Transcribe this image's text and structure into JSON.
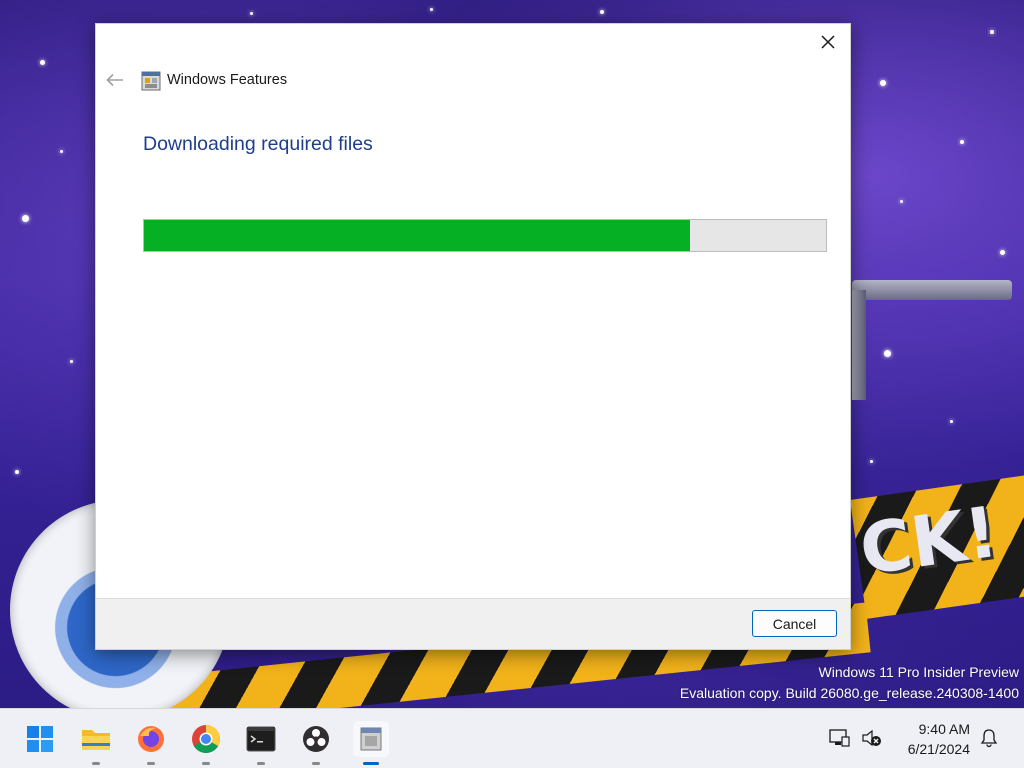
{
  "dialog": {
    "title": "Windows Features",
    "heading": "Downloading required files",
    "progress_percent": 80,
    "cancel_label": "Cancel",
    "back_icon": "arrow-left-icon",
    "close_icon": "close-icon",
    "app_icon": "windows-features-icon"
  },
  "desktop": {
    "watermark_line1": "Windows 11 Pro Insider Preview",
    "watermark_line2": "Evaluation copy. Build 26080.ge_release.240308-1400"
  },
  "taskbar": {
    "apps": [
      {
        "name": "start-icon"
      },
      {
        "name": "file-explorer-icon"
      },
      {
        "name": "firefox-icon"
      },
      {
        "name": "chrome-icon"
      },
      {
        "name": "terminal-icon"
      },
      {
        "name": "obs-icon"
      },
      {
        "name": "windows-features-icon",
        "active": true
      }
    ],
    "time": "9:40 AM",
    "date": "6/21/2024"
  },
  "colors": {
    "accent": "#0067c0",
    "progress_fill": "#06b025",
    "heading": "#1e3e8c"
  }
}
